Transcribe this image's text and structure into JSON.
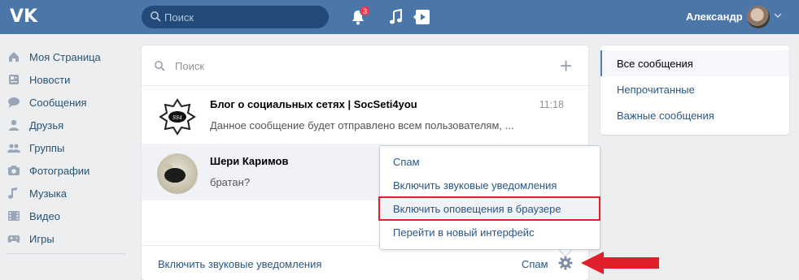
{
  "header": {
    "logo": "VK",
    "search_placeholder": "Поиск",
    "notifications_count": "3",
    "user_name": "Александр"
  },
  "nav": {
    "items": [
      {
        "label": "Моя Страница",
        "icon": "home-icon"
      },
      {
        "label": "Новости",
        "icon": "news-icon"
      },
      {
        "label": "Сообщения",
        "icon": "messages-icon"
      },
      {
        "label": "Друзья",
        "icon": "friend-icon"
      },
      {
        "label": "Группы",
        "icon": "groups-icon"
      },
      {
        "label": "Фотографии",
        "icon": "camera-icon"
      },
      {
        "label": "Музыка",
        "icon": "music-icon"
      },
      {
        "label": "Видео",
        "icon": "video-icon"
      },
      {
        "label": "Игры",
        "icon": "gamepad-icon"
      }
    ]
  },
  "main": {
    "search_placeholder": "Поиск",
    "dialogs": [
      {
        "name": "Блог о социальных сетях | SocSeti4you",
        "time": "11:18",
        "text": "Данное сообщение будет отправлено всем пользователям, ..."
      },
      {
        "name": "Шери Каримов",
        "time": "",
        "text": "братан?"
      }
    ],
    "footer": {
      "sound_label": "Включить звуковые уведомления",
      "spam_label": "Спам"
    }
  },
  "menu": {
    "items": [
      {
        "label": "Спам"
      },
      {
        "label": "Включить звуковые уведомления"
      },
      {
        "label": "Включить оповещения в браузере"
      },
      {
        "label": "Перейти в новый интерфейс"
      }
    ]
  },
  "right_panel": {
    "items": [
      {
        "label": "Все сообщения"
      },
      {
        "label": "Непрочитанные"
      },
      {
        "label": "Важные сообщения"
      }
    ]
  },
  "colors": {
    "header": "#4a76a8",
    "link": "#2a5885",
    "highlight": "#e0202a"
  }
}
